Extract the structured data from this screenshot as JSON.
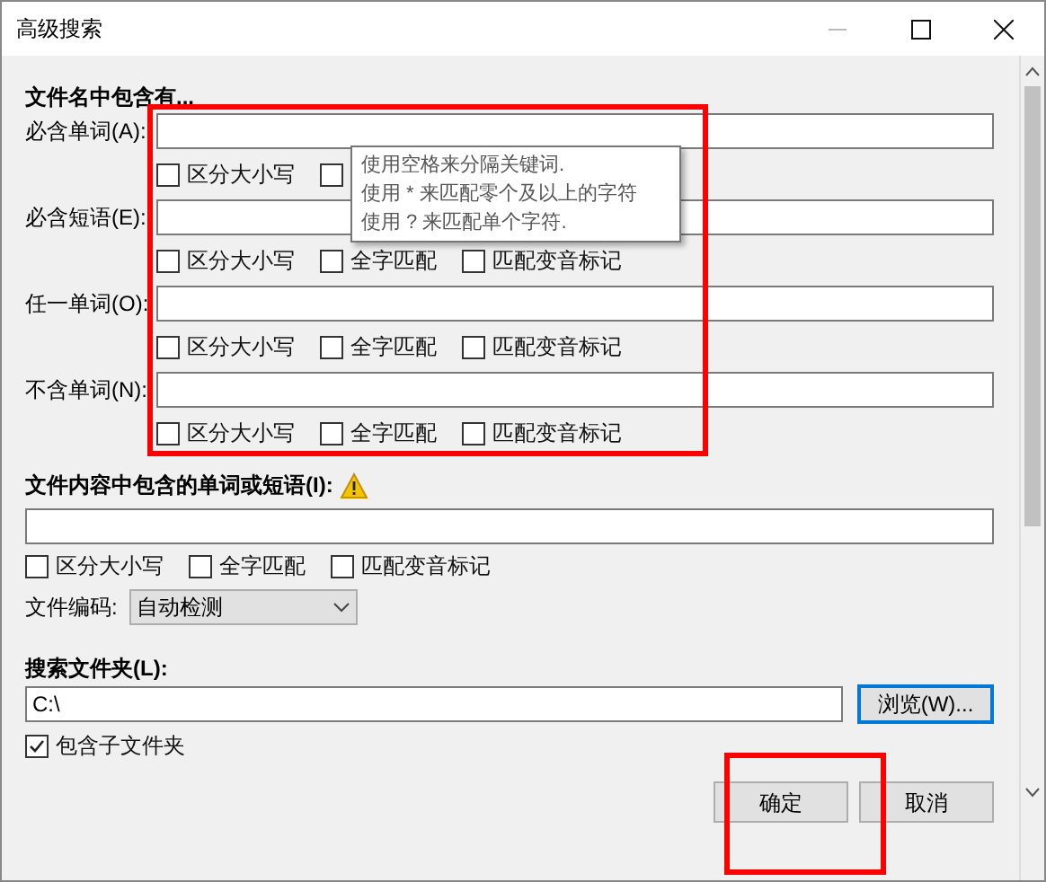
{
  "window": {
    "title": "高级搜索"
  },
  "filename_section": {
    "title": "文件名中包含有...",
    "rows": [
      {
        "label": "必含单词(A):",
        "options": [
          {
            "label": "区分大小写",
            "checked": false
          },
          {
            "checked": false
          }
        ]
      },
      {
        "label": "必含短语(E):",
        "options": [
          {
            "label": "区分大小写",
            "checked": false
          },
          {
            "label": "全字匹配",
            "checked": false
          },
          {
            "label": "匹配变音标记",
            "checked": false
          }
        ]
      },
      {
        "label": "任一单词(O):",
        "options": [
          {
            "label": "区分大小写",
            "checked": false
          },
          {
            "label": "全字匹配",
            "checked": false
          },
          {
            "label": "匹配变音标记",
            "checked": false
          }
        ]
      },
      {
        "label": "不含单词(N):",
        "options": [
          {
            "label": "区分大小写",
            "checked": false
          },
          {
            "label": "全字匹配",
            "checked": false
          },
          {
            "label": "匹配变音标记",
            "checked": false
          }
        ]
      }
    ]
  },
  "tooltip": {
    "lines": [
      "使用空格来分隔关键词.",
      "使用 * 来匹配零个及以上的字符",
      "使用 ? 来匹配单个字符."
    ]
  },
  "content_section": {
    "title": "文件内容中包含的单词或短语(I):",
    "options": [
      {
        "label": "区分大小写",
        "checked": false
      },
      {
        "label": "全字匹配",
        "checked": false
      },
      {
        "label": "匹配变音标记",
        "checked": false
      }
    ],
    "encoding_label": "文件编码:",
    "encoding_value": "自动检测"
  },
  "folder_section": {
    "title": "搜索文件夹(L):",
    "value": "C:\\",
    "browse": "浏览(W)...",
    "include_subfolders": {
      "label": "包含子文件夹",
      "checked": true
    }
  },
  "buttons": [
    {
      "label": "确定"
    },
    {
      "label": "取消"
    }
  ]
}
